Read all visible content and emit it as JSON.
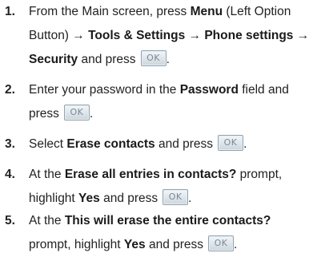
{
  "steps": [
    {
      "number": "1.",
      "lines": [
        [
          "From the Main screen, press ",
          {
            "b": "Menu"
          },
          " (Left Option"
        ],
        [
          "Button) ",
          {
            "b": "→ Tools & Settings → Phone settings →"
          }
        ],
        [
          {
            "b": "Security"
          },
          " and press",
          {
            "ok": true
          },
          "."
        ]
      ]
    },
    {
      "number": "2.",
      "lines": [
        [
          "Enter your password in the ",
          {
            "b": "Password"
          },
          " field and"
        ],
        [
          "press",
          {
            "ok": true
          },
          "."
        ]
      ]
    },
    {
      "number": "3.",
      "lines": [
        [
          "Select ",
          {
            "b": "Erase contacts"
          },
          " and press",
          {
            "ok": true
          },
          "."
        ]
      ]
    },
    {
      "number": "4.",
      "lines": [
        [
          "At the ",
          {
            "b": "Erase all entries in contacts?"
          },
          " prompt,"
        ],
        [
          "highlight ",
          {
            "b": "Yes"
          },
          " and press",
          {
            "ok": true
          },
          "."
        ]
      ]
    },
    {
      "number": "5.",
      "lines": [
        [
          "At the ",
          {
            "b": "This will erase the entire contacts?"
          }
        ],
        [
          "prompt, highlight ",
          {
            "b": "Yes"
          },
          " and press",
          {
            "ok": true
          },
          "."
        ]
      ]
    }
  ],
  "ok_label": "OK",
  "ok_icon": "ok-key-icon"
}
